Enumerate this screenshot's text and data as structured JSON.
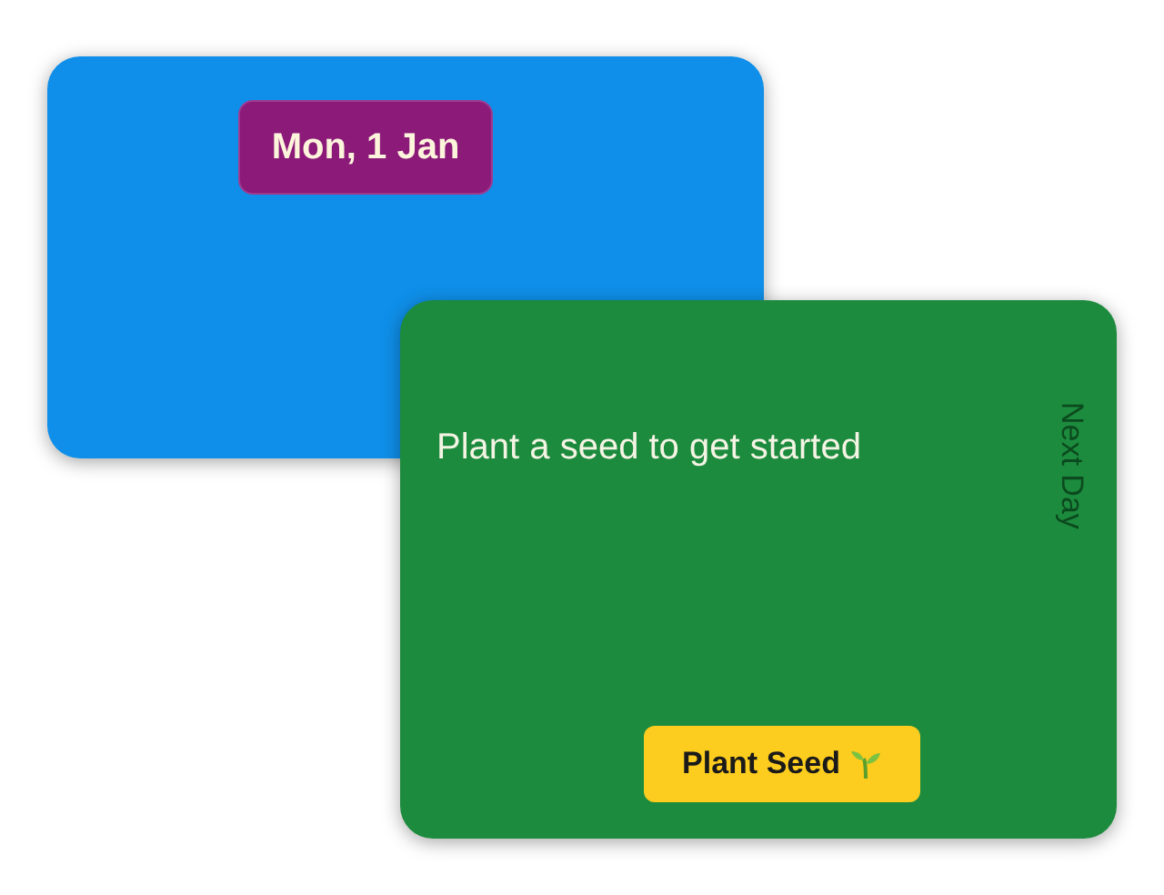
{
  "date_card": {
    "date": "Mon, 1 Jan"
  },
  "seed_card": {
    "message": "Plant a seed to get started",
    "next_label": "Next Day",
    "button": "Plant Seed"
  }
}
